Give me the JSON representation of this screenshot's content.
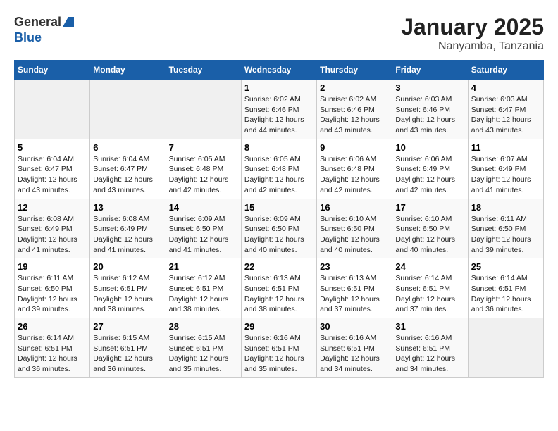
{
  "header": {
    "logo_general": "General",
    "logo_blue": "Blue",
    "title": "January 2025",
    "subtitle": "Nanyamba, Tanzania"
  },
  "weekdays": [
    "Sunday",
    "Monday",
    "Tuesday",
    "Wednesday",
    "Thursday",
    "Friday",
    "Saturday"
  ],
  "weeks": [
    [
      {
        "day": "",
        "info": ""
      },
      {
        "day": "",
        "info": ""
      },
      {
        "day": "",
        "info": ""
      },
      {
        "day": "1",
        "info": "Sunrise: 6:02 AM\nSunset: 6:46 PM\nDaylight: 12 hours\nand 44 minutes."
      },
      {
        "day": "2",
        "info": "Sunrise: 6:02 AM\nSunset: 6:46 PM\nDaylight: 12 hours\nand 43 minutes."
      },
      {
        "day": "3",
        "info": "Sunrise: 6:03 AM\nSunset: 6:46 PM\nDaylight: 12 hours\nand 43 minutes."
      },
      {
        "day": "4",
        "info": "Sunrise: 6:03 AM\nSunset: 6:47 PM\nDaylight: 12 hours\nand 43 minutes."
      }
    ],
    [
      {
        "day": "5",
        "info": "Sunrise: 6:04 AM\nSunset: 6:47 PM\nDaylight: 12 hours\nand 43 minutes."
      },
      {
        "day": "6",
        "info": "Sunrise: 6:04 AM\nSunset: 6:47 PM\nDaylight: 12 hours\nand 43 minutes."
      },
      {
        "day": "7",
        "info": "Sunrise: 6:05 AM\nSunset: 6:48 PM\nDaylight: 12 hours\nand 42 minutes."
      },
      {
        "day": "8",
        "info": "Sunrise: 6:05 AM\nSunset: 6:48 PM\nDaylight: 12 hours\nand 42 minutes."
      },
      {
        "day": "9",
        "info": "Sunrise: 6:06 AM\nSunset: 6:48 PM\nDaylight: 12 hours\nand 42 minutes."
      },
      {
        "day": "10",
        "info": "Sunrise: 6:06 AM\nSunset: 6:49 PM\nDaylight: 12 hours\nand 42 minutes."
      },
      {
        "day": "11",
        "info": "Sunrise: 6:07 AM\nSunset: 6:49 PM\nDaylight: 12 hours\nand 41 minutes."
      }
    ],
    [
      {
        "day": "12",
        "info": "Sunrise: 6:08 AM\nSunset: 6:49 PM\nDaylight: 12 hours\nand 41 minutes."
      },
      {
        "day": "13",
        "info": "Sunrise: 6:08 AM\nSunset: 6:49 PM\nDaylight: 12 hours\nand 41 minutes."
      },
      {
        "day": "14",
        "info": "Sunrise: 6:09 AM\nSunset: 6:50 PM\nDaylight: 12 hours\nand 41 minutes."
      },
      {
        "day": "15",
        "info": "Sunrise: 6:09 AM\nSunset: 6:50 PM\nDaylight: 12 hours\nand 40 minutes."
      },
      {
        "day": "16",
        "info": "Sunrise: 6:10 AM\nSunset: 6:50 PM\nDaylight: 12 hours\nand 40 minutes."
      },
      {
        "day": "17",
        "info": "Sunrise: 6:10 AM\nSunset: 6:50 PM\nDaylight: 12 hours\nand 40 minutes."
      },
      {
        "day": "18",
        "info": "Sunrise: 6:11 AM\nSunset: 6:50 PM\nDaylight: 12 hours\nand 39 minutes."
      }
    ],
    [
      {
        "day": "19",
        "info": "Sunrise: 6:11 AM\nSunset: 6:50 PM\nDaylight: 12 hours\nand 39 minutes."
      },
      {
        "day": "20",
        "info": "Sunrise: 6:12 AM\nSunset: 6:51 PM\nDaylight: 12 hours\nand 38 minutes."
      },
      {
        "day": "21",
        "info": "Sunrise: 6:12 AM\nSunset: 6:51 PM\nDaylight: 12 hours\nand 38 minutes."
      },
      {
        "day": "22",
        "info": "Sunrise: 6:13 AM\nSunset: 6:51 PM\nDaylight: 12 hours\nand 38 minutes."
      },
      {
        "day": "23",
        "info": "Sunrise: 6:13 AM\nSunset: 6:51 PM\nDaylight: 12 hours\nand 37 minutes."
      },
      {
        "day": "24",
        "info": "Sunrise: 6:14 AM\nSunset: 6:51 PM\nDaylight: 12 hours\nand 37 minutes."
      },
      {
        "day": "25",
        "info": "Sunrise: 6:14 AM\nSunset: 6:51 PM\nDaylight: 12 hours\nand 36 minutes."
      }
    ],
    [
      {
        "day": "26",
        "info": "Sunrise: 6:14 AM\nSunset: 6:51 PM\nDaylight: 12 hours\nand 36 minutes."
      },
      {
        "day": "27",
        "info": "Sunrise: 6:15 AM\nSunset: 6:51 PM\nDaylight: 12 hours\nand 36 minutes."
      },
      {
        "day": "28",
        "info": "Sunrise: 6:15 AM\nSunset: 6:51 PM\nDaylight: 12 hours\nand 35 minutes."
      },
      {
        "day": "29",
        "info": "Sunrise: 6:16 AM\nSunset: 6:51 PM\nDaylight: 12 hours\nand 35 minutes."
      },
      {
        "day": "30",
        "info": "Sunrise: 6:16 AM\nSunset: 6:51 PM\nDaylight: 12 hours\nand 34 minutes."
      },
      {
        "day": "31",
        "info": "Sunrise: 6:16 AM\nSunset: 6:51 PM\nDaylight: 12 hours\nand 34 minutes."
      },
      {
        "day": "",
        "info": ""
      }
    ]
  ]
}
